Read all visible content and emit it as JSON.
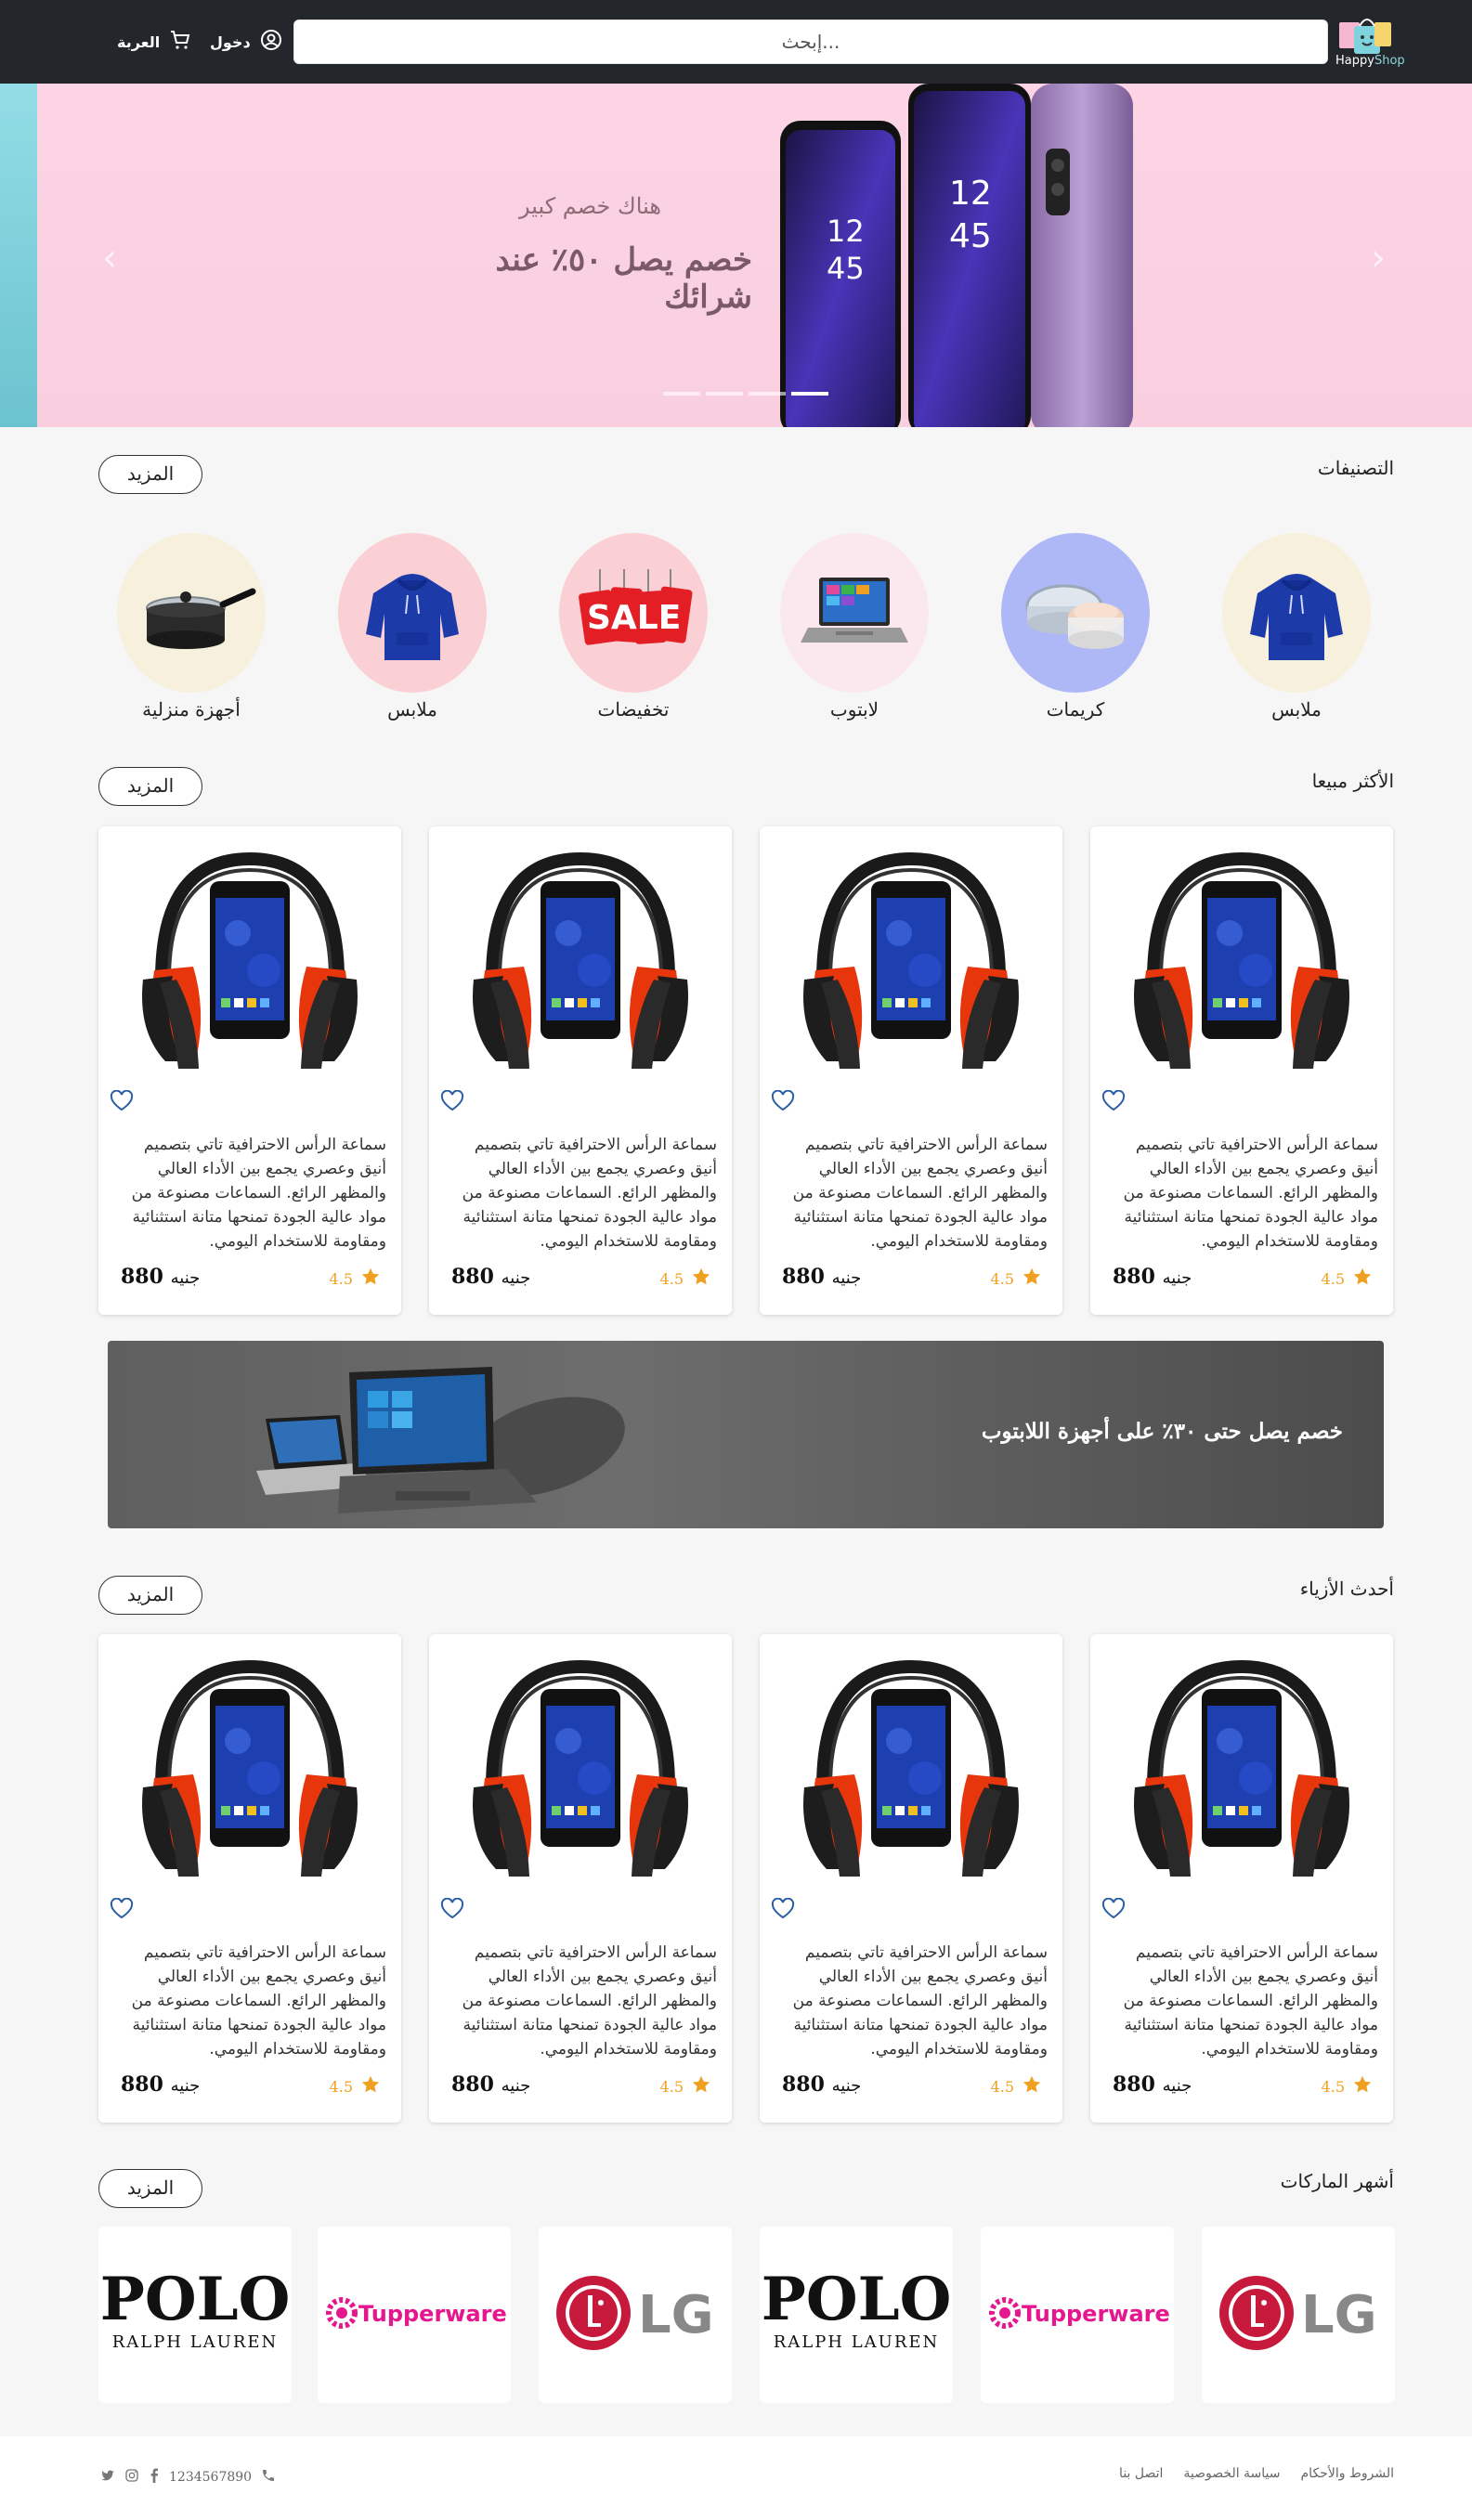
{
  "header": {
    "logo_text_a": "Happy",
    "logo_text_b": "Shop",
    "search_placeholder": "إبحث...",
    "login_label": "دخول",
    "cart_label": "العربة"
  },
  "hero": {
    "subtitle": "هناك خصم كبير",
    "title": "خصم يصل ٥٠٪ عند شرائك",
    "slide_count": 4,
    "active_slide": 4
  },
  "categories": {
    "title": "التصنيفات",
    "more_label": "المزيد",
    "items": [
      {
        "label": "ملابس",
        "icon": "hoodie-icon",
        "bg": "#f7f0dd"
      },
      {
        "label": "كريمات",
        "icon": "cream-jar-icon",
        "bg": "#aeb8f6"
      },
      {
        "label": "لابتوب",
        "icon": "laptop-icon",
        "bg": "#fbe7ee"
      },
      {
        "label": "تخفيضات",
        "icon": "sale-tags-icon",
        "bg": "#fbd0d5"
      },
      {
        "label": "ملابس",
        "icon": "hoodie-icon",
        "bg": "#fbd0d5"
      },
      {
        "label": "أجهزة منزلية",
        "icon": "cooking-pot-icon",
        "bg": "#f7f0dd"
      }
    ]
  },
  "bestsellers": {
    "title": "الأكثر مبيعا",
    "more_label": "المزيد",
    "products": [
      {
        "desc": "سماعة الرأس الاحترافية تاتي بتصميم أنيق وعصري يجمع بين الأداء العالي والمظهر الرائع. السماعات مصنوعة من مواد عالية الجودة تمنحها متانة استثنائية ومقاومة للاستخدام اليومي.",
        "price": "880",
        "currency": "جنيه",
        "rating": "4.5"
      },
      {
        "desc": "سماعة الرأس الاحترافية تاتي بتصميم أنيق وعصري يجمع بين الأداء العالي والمظهر الرائع. السماعات مصنوعة من مواد عالية الجودة تمنحها متانة استثنائية ومقاومة للاستخدام اليومي.",
        "price": "880",
        "currency": "جنيه",
        "rating": "4.5"
      },
      {
        "desc": "سماعة الرأس الاحترافية تاتي بتصميم أنيق وعصري يجمع بين الأداء العالي والمظهر الرائع. السماعات مصنوعة من مواد عالية الجودة تمنحها متانة استثنائية ومقاومة للاستخدام اليومي.",
        "price": "880",
        "currency": "جنيه",
        "rating": "4.5"
      },
      {
        "desc": "سماعة الرأس الاحترافية تاتي بتصميم أنيق وعصري يجمع بين الأداء العالي والمظهر الرائع. السماعات مصنوعة من مواد عالية الجودة تمنحها متانة استثنائية ومقاومة للاستخدام اليومي.",
        "price": "880",
        "currency": "جنيه",
        "rating": "4.5"
      }
    ]
  },
  "promo": {
    "text": "خصم يصل حتى ٣٠٪ على أجهزة اللابتوب"
  },
  "latest": {
    "title": "أحدث الأزياء",
    "more_label": "المزيد",
    "products": [
      {
        "desc": "سماعة الرأس الاحترافية تاتي بتصميم أنيق وعصري يجمع بين الأداء العالي والمظهر الرائع. السماعات مصنوعة من مواد عالية الجودة تمنحها متانة استثنائية ومقاومة للاستخدام اليومي.",
        "price": "880",
        "currency": "جنيه",
        "rating": "4.5"
      },
      {
        "desc": "سماعة الرأس الاحترافية تاتي بتصميم أنيق وعصري يجمع بين الأداء العالي والمظهر الرائع. السماعات مصنوعة من مواد عالية الجودة تمنحها متانة استثنائية ومقاومة للاستخدام اليومي.",
        "price": "880",
        "currency": "جنيه",
        "rating": "4.5"
      },
      {
        "desc": "سماعة الرأس الاحترافية تاتي بتصميم أنيق وعصري يجمع بين الأداء العالي والمظهر الرائع. السماعات مصنوعة من مواد عالية الجودة تمنحها متانة استثنائية ومقاومة للاستخدام اليومي.",
        "price": "880",
        "currency": "جنيه",
        "rating": "4.5"
      },
      {
        "desc": "سماعة الرأس الاحترافية تاتي بتصميم أنيق وعصري يجمع بين الأداء العالي والمظهر الرائع. السماعات مصنوعة من مواد عالية الجودة تمنحها متانة استثنائية ومقاومة للاستخدام اليومي.",
        "price": "880",
        "currency": "جنيه",
        "rating": "4.5"
      }
    ]
  },
  "brands": {
    "title": "أشهر الماركات",
    "more_label": "المزيد",
    "items": [
      {
        "name": "LG",
        "logo": "lg-logo"
      },
      {
        "name": "Tupperware",
        "logo": "tupperware-logo"
      },
      {
        "name": "POLO",
        "sub": "RALPH LAUREN",
        "logo": "polo-logo"
      },
      {
        "name": "LG",
        "logo": "lg-logo"
      },
      {
        "name": "Tupperware",
        "logo": "tupperware-logo"
      },
      {
        "name": "POLO",
        "sub": "RALPH LAUREN",
        "logo": "polo-logo"
      }
    ]
  },
  "footer": {
    "links": [
      "الشروط والأحكام",
      "سياسة الخصوصية",
      "اتصل بنا"
    ],
    "phone": "1234567890",
    "social": [
      "facebook-icon",
      "instagram-icon",
      "twitter-icon"
    ]
  },
  "colors": {
    "header_bg": "#23272b",
    "page_bg": "#f6f6f6",
    "star": "#f0a020",
    "accent_pink": "#fcd4e4"
  }
}
